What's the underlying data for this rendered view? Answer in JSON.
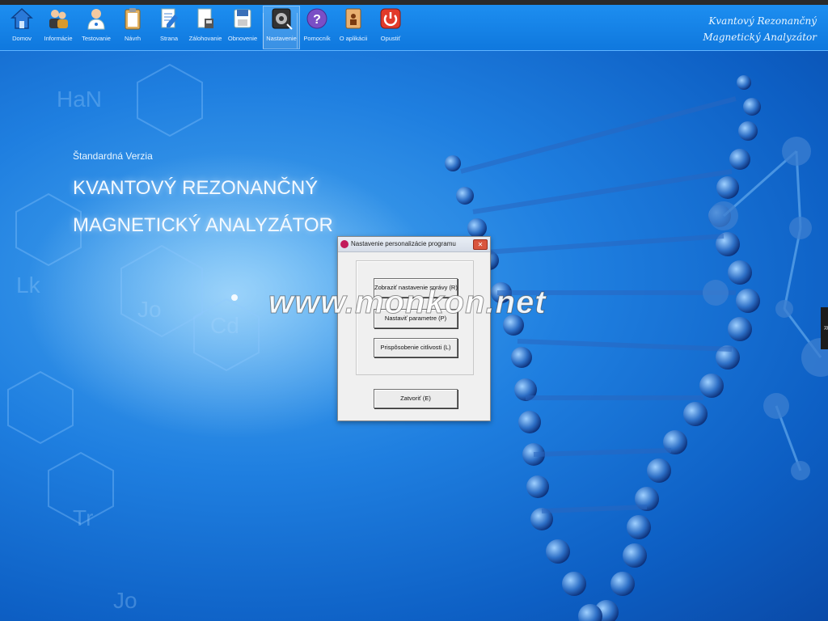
{
  "toolbar": {
    "items": [
      {
        "label": "Domov",
        "icon": "home-icon"
      },
      {
        "label": "Informácie",
        "icon": "users-icon"
      },
      {
        "label": "Testovanie",
        "icon": "doctor-icon"
      },
      {
        "label": "Návrh",
        "icon": "clipboard-icon"
      },
      {
        "label": "Strana",
        "icon": "edit-page-icon"
      },
      {
        "label": "Zálohovanie",
        "icon": "backup-icon"
      },
      {
        "label": "Obnovenie",
        "icon": "restore-icon"
      },
      {
        "label": "Nastavenie",
        "icon": "settings-icon"
      },
      {
        "label": "Pomocník",
        "icon": "help-icon"
      },
      {
        "label": "O aplikácii",
        "icon": "about-icon"
      },
      {
        "label": "Opustiť",
        "icon": "power-icon"
      }
    ],
    "active": "Nastavenie"
  },
  "brand": {
    "line1": "Kvantový Rezonančný",
    "line2": "Magnetický Analyzátor"
  },
  "hero": {
    "subtitle": "Štandardná Verzia",
    "title_line1": "KVANTOVÝ REZONANČNÝ",
    "title_line2": "MAGNETICKÝ ANALYZÁTOR"
  },
  "dialog": {
    "title": "Nastavenie personalizácie programu",
    "buttons": [
      {
        "label": "Zobraziť nastavenie správy (R)"
      },
      {
        "label": "Nastaviť parametre (P)"
      },
      {
        "label": "Prispôsobenie citlivosti (L)"
      }
    ],
    "close_button": "Zatvoriť (E)"
  },
  "watermark": "www.monkon.net",
  "side_tab": "R"
}
